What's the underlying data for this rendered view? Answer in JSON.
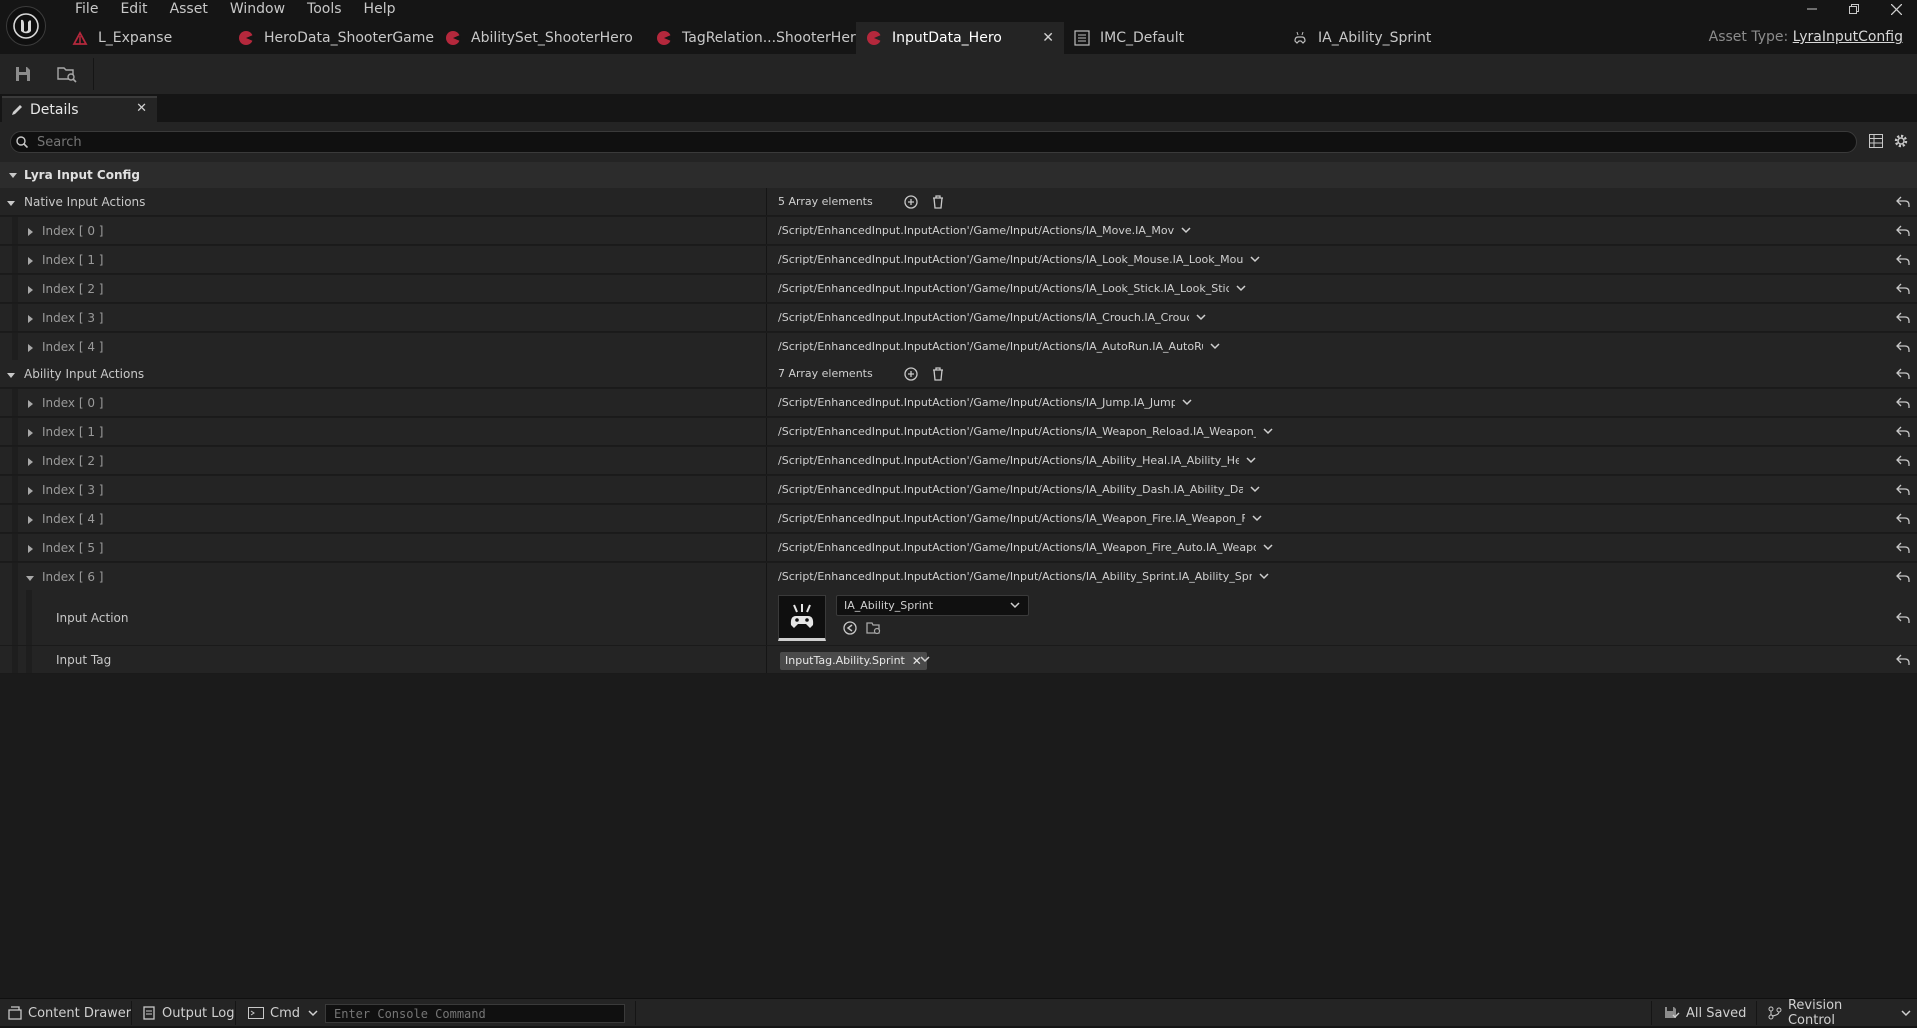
{
  "menu": [
    "File",
    "Edit",
    "Asset",
    "Window",
    "Tools",
    "Help"
  ],
  "tabs": [
    {
      "label": "L_Expanse",
      "icon": "level-icon",
      "active": false
    },
    {
      "label": "HeroData_ShooterGame",
      "icon": "data-asset-icon",
      "active": false
    },
    {
      "label": "AbilitySet_ShooterHero",
      "icon": "data-asset-icon",
      "active": false
    },
    {
      "label": "TagRelation...ShooterHero",
      "icon": "data-asset-icon",
      "active": false
    },
    {
      "label": "InputData_Hero",
      "icon": "data-asset-icon",
      "active": true
    },
    {
      "label": "IMC_Default",
      "icon": "mapping-context-icon",
      "active": false
    },
    {
      "label": "IA_Ability_Sprint",
      "icon": "input-action-icon",
      "active": false
    }
  ],
  "asset_type": {
    "label": "Asset Type:",
    "value": "LyraInputConfig"
  },
  "details": {
    "tab_label": "Details",
    "search_placeholder": "Search",
    "category": "Lyra Input Config",
    "native": {
      "label": "Native Input Actions",
      "count": "5 Array elements",
      "items": [
        {
          "index": "Index [ 0 ]",
          "value": "/Script/EnhancedInput.InputAction'/Game/Input/Actions/IA_Move.IA_Move'"
        },
        {
          "index": "Index [ 1 ]",
          "value": "/Script/EnhancedInput.InputAction'/Game/Input/Actions/IA_Look_Mouse.IA_Look_Mouse'"
        },
        {
          "index": "Index [ 2 ]",
          "value": "/Script/EnhancedInput.InputAction'/Game/Input/Actions/IA_Look_Stick.IA_Look_Stick'"
        },
        {
          "index": "Index [ 3 ]",
          "value": "/Script/EnhancedInput.InputAction'/Game/Input/Actions/IA_Crouch.IA_Crouch'"
        },
        {
          "index": "Index [ 4 ]",
          "value": "/Script/EnhancedInput.InputAction'/Game/Input/Actions/IA_AutoRun.IA_AutoRun'"
        }
      ]
    },
    "ability": {
      "label": "Ability Input Actions",
      "count": "7 Array elements",
      "items": [
        {
          "index": "Index [ 0 ]",
          "value": "/Script/EnhancedInput.InputAction'/Game/Input/Actions/IA_Jump.IA_Jump'"
        },
        {
          "index": "Index [ 1 ]",
          "value": "/Script/EnhancedInput.InputAction'/Game/Input/Actions/IA_Weapon_Reload.IA_Weapon_Rel"
        },
        {
          "index": "Index [ 2 ]",
          "value": "/Script/EnhancedInput.InputAction'/Game/Input/Actions/IA_Ability_Heal.IA_Ability_Heal'"
        },
        {
          "index": "Index [ 3 ]",
          "value": "/Script/EnhancedInput.InputAction'/Game/Input/Actions/IA_Ability_Dash.IA_Ability_Dash'"
        },
        {
          "index": "Index [ 4 ]",
          "value": "/Script/EnhancedInput.InputAction'/Game/Input/Actions/IA_Weapon_Fire.IA_Weapon_Fire'"
        },
        {
          "index": "Index [ 5 ]",
          "value": "/Script/EnhancedInput.InputAction'/Game/Input/Actions/IA_Weapon_Fire_Auto.IA_Weapon_F"
        },
        {
          "index": "Index [ 6 ]",
          "value": "/Script/EnhancedInput.InputAction'/Game/Input/Actions/IA_Ability_Sprint.IA_Ability_Sprint'"
        }
      ],
      "expanded": {
        "input_action_label": "Input Action",
        "input_action_value": "IA_Ability_Sprint",
        "input_tag_label": "Input Tag",
        "input_tag_value": "InputTag.Ability.Sprint"
      }
    }
  },
  "statusbar": {
    "content_drawer": "Content Drawer",
    "output_log": "Output Log",
    "cmd": "Cmd",
    "console_placeholder": "Enter Console Command",
    "all_saved": "All Saved",
    "revision_control": "Revision Control"
  },
  "colors": {
    "accent_red": "#b4283c",
    "panel": "#242424",
    "background": "#151515"
  }
}
